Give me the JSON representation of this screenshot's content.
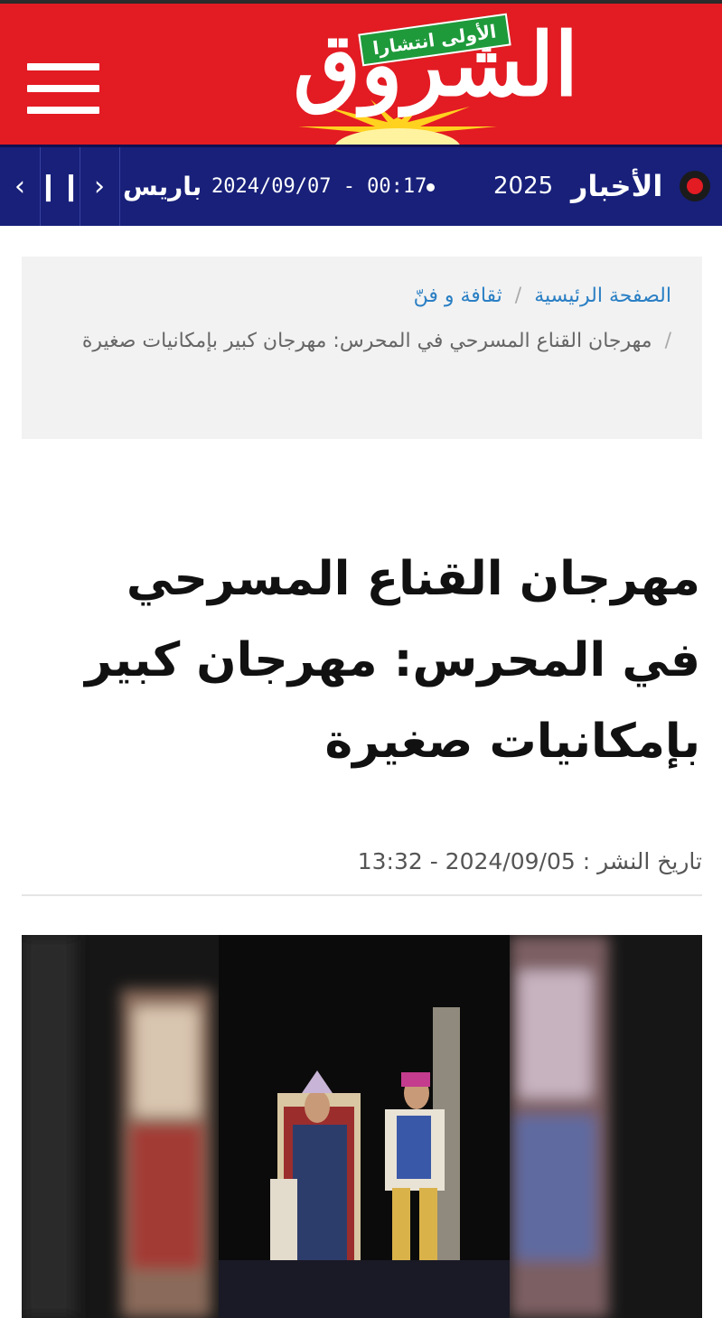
{
  "header": {
    "logo_text": "الشروق",
    "logo_badge": "الأولى انتشارا",
    "menu_icon": "hamburger-menu-icon",
    "bg_color": "#e31b23"
  },
  "ticker": {
    "label": "الأخبار",
    "headline_fragment": "2025",
    "timestamp": "2024/09/07 - 00:17",
    "location": "باريس",
    "controls": [
      "chevron-left-icon",
      "pause-icon",
      "chevron-right-icon"
    ],
    "live_indicator": "live-dot-icon",
    "bg_color": "#18207a"
  },
  "breadcrumb": {
    "home": "الصفحة الرئيسية",
    "separator": "/",
    "category": "ثقافة و فنّ",
    "current": "مهرجان القناع المسرحي في المحرس: مهرجان كبير بإمكانيات صغيرة"
  },
  "article": {
    "title": "مهرجان القناع المسرحي في المحرس: مهرجان كبير بإمكانيات صغيرة",
    "published_label": "تاريخ النشر :",
    "published_date": "13:32 - 2024/09/05",
    "image_alt": "stage-performance-photo"
  }
}
